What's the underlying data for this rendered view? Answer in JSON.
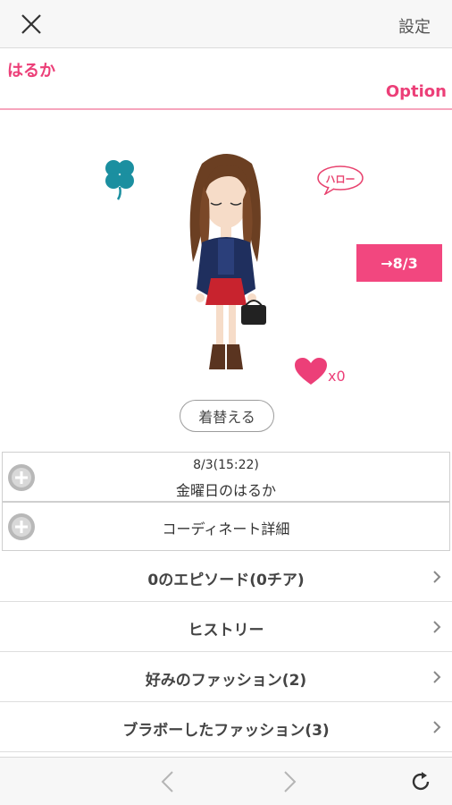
{
  "topbar": {
    "close_icon": "close-icon",
    "settings_label": "設定"
  },
  "profile": {
    "name": "はるか",
    "option_label": "Option"
  },
  "stage": {
    "bubble_text": "ハロー",
    "date_button": "→8/3",
    "heart_count": "x0",
    "dress_up_button": "着替える",
    "icons": [
      "clover-icon",
      "speech-bubble-icon",
      "heart-icon"
    ]
  },
  "diary": {
    "timestamp": "8/3(15:22)",
    "title": "金曜日のはるか",
    "coordinate_label": "コーディネート詳細"
  },
  "menu": [
    {
      "label": "0のエピソード(0チア)"
    },
    {
      "label": "ヒストリー"
    },
    {
      "label": "好みのファッション(2)"
    },
    {
      "label": "ブラボーしたファッション(3)"
    }
  ],
  "colors": {
    "accent": "#ec3f78",
    "button_pink": "#f2477f",
    "clover": "#1b8fa0",
    "divider_pink": "#f6a5bd"
  },
  "bottombar": {
    "icons": [
      "back-arrow-icon",
      "forward-arrow-icon",
      "reload-icon"
    ]
  }
}
